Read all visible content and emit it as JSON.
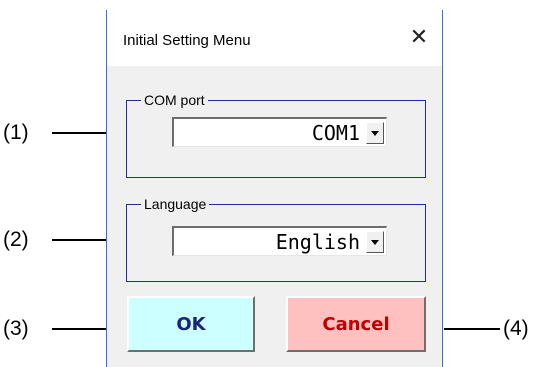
{
  "dialog": {
    "title": "Initial Setting Menu",
    "close_glyph": "✕"
  },
  "com_port_group": {
    "label": "COM port",
    "selected": "COM1"
  },
  "language_group": {
    "label": "Language",
    "selected": "English"
  },
  "buttons": {
    "ok_label": "OK",
    "cancel_label": "Cancel"
  },
  "callouts": [
    "(1)",
    "(2)",
    "(3)",
    "(4)"
  ],
  "colors": {
    "ok_bg": "#ccffff",
    "ok_text": "#1a237e",
    "cancel_bg": "#ffc0c0",
    "cancel_text": "#c00000",
    "group_border": "#1f2ea8"
  },
  "icons": {
    "close": "close-icon",
    "dropdown": "chevron-down-icon"
  }
}
